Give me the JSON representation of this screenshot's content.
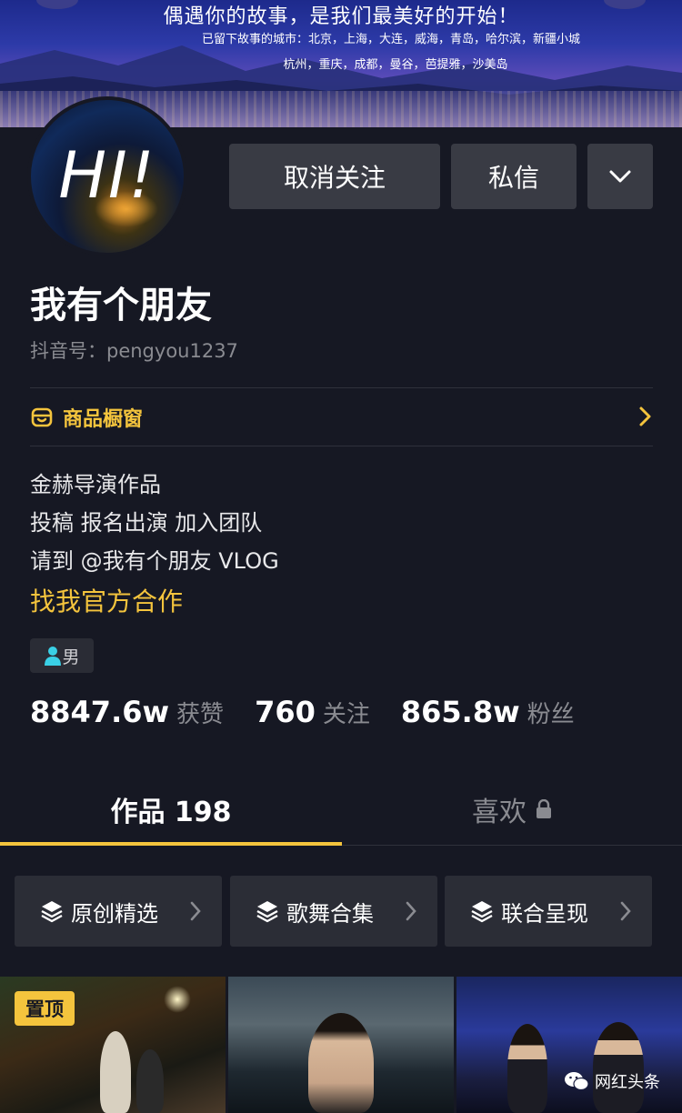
{
  "banner": {
    "headline": "偶遇你的故事，是我们最美好的开始！",
    "cities_line1": "已留下故事的城市：北京，上海，大连，威海，青岛，哈尔滨，新疆小城",
    "cities_line2": "杭州，重庆，成都，曼谷，芭提雅，沙美岛"
  },
  "avatar": {
    "text": "HI!"
  },
  "actions": {
    "unfollow": "取消关注",
    "message": "私信",
    "more_icon": "chevron-down-icon"
  },
  "profile": {
    "name": "我有个朋友",
    "douyin_id": "抖音号：pengyou1237",
    "shop_label": "商品橱窗",
    "bio": [
      "金赫导演作品",
      "投稿 报名出演 加入团队",
      "请到 @我有个朋友 VLOG"
    ],
    "bio_link": "找我官方合作",
    "gender": "男"
  },
  "stats": [
    {
      "value": "8847.6w",
      "label": "获赞"
    },
    {
      "value": "760",
      "label": "关注"
    },
    {
      "value": "865.8w",
      "label": "粉丝"
    }
  ],
  "tabs": {
    "works": "作品 198",
    "likes": "喜欢"
  },
  "collections": [
    "原创精选",
    "歌舞合集",
    "联合呈现"
  ],
  "videos": {
    "pinned_label": "置顶"
  },
  "watermark": "网红头条",
  "colors": {
    "background": "#161823",
    "accent": "#f4c43d",
    "button": "#393b44"
  }
}
